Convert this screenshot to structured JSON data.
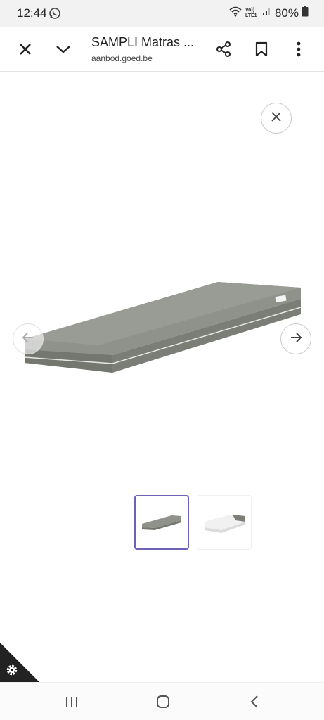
{
  "status_bar": {
    "time": "12:44",
    "left_icon": "whatsapp-icon",
    "signal_label": "Vo)) LTE1",
    "battery": "80%"
  },
  "toolbar": {
    "title": "SAMPLI Matras ...",
    "url": "aanbod.goed.be",
    "icons": [
      "close-icon",
      "chevron-down-icon",
      "share-icon",
      "bookmark-icon",
      "more-vert-icon"
    ]
  },
  "gallery": {
    "close_icon": "close-icon",
    "prev_icon": "arrow-left-icon",
    "next_icon": "arrow-right-icon",
    "thumbnails": [
      {
        "name": "thumbnail-grey-mattress",
        "selected": true
      },
      {
        "name": "thumbnail-white-mattress",
        "selected": false
      }
    ],
    "accent_color": "#6c63b8",
    "mattress_color": "#8f928a"
  },
  "settings_icon": "gear-icon",
  "nav": {
    "icons": [
      "recent-apps-icon",
      "home-icon",
      "back-icon"
    ]
  }
}
